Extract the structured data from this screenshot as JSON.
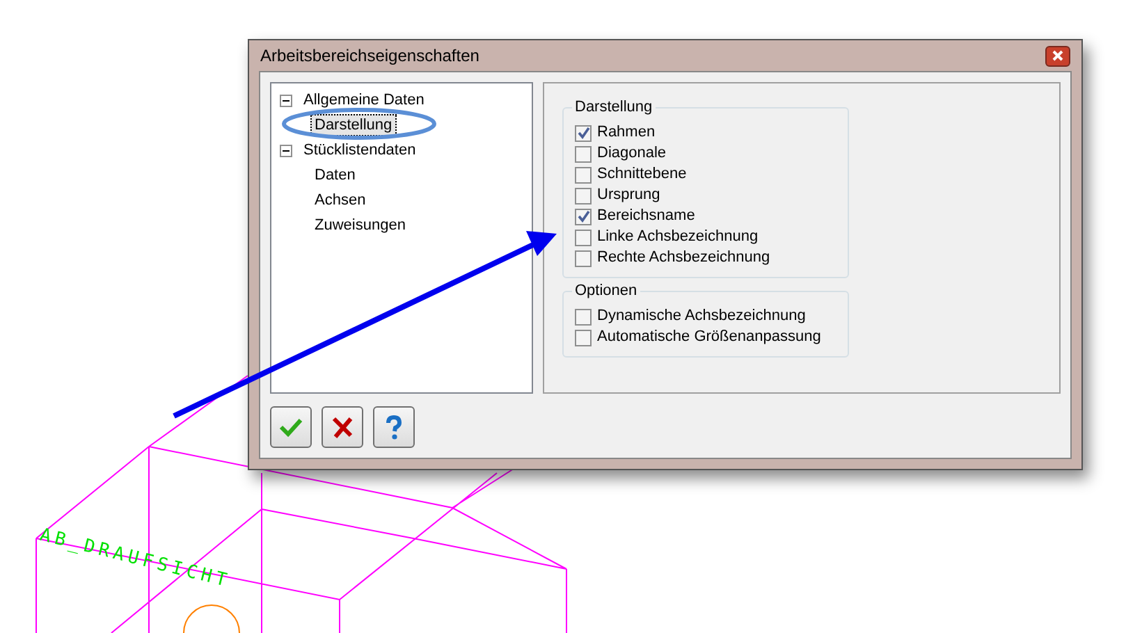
{
  "canvas": {
    "view_label": "AB_DRAUFSICHT"
  },
  "dialog": {
    "title": "Arbeitsbereichseigenschaften",
    "tree": [
      {
        "label": "Allgemeine Daten",
        "expanded": true,
        "selected": false,
        "children": [
          {
            "label": "Darstellung",
            "selected": true
          }
        ]
      },
      {
        "label": "Stücklistendaten",
        "expanded": true,
        "selected": false,
        "children": [
          {
            "label": "Daten",
            "selected": false
          },
          {
            "label": "Achsen",
            "selected": false
          },
          {
            "label": "Zuweisungen",
            "selected": false
          }
        ]
      }
    ],
    "groups": [
      {
        "title": "Darstellung",
        "options": [
          {
            "label": "Rahmen",
            "checked": true
          },
          {
            "label": "Diagonale",
            "checked": false
          },
          {
            "label": "Schnittebene",
            "checked": false
          },
          {
            "label": "Ursprung",
            "checked": false
          },
          {
            "label": "Bereichsname",
            "checked": true
          },
          {
            "label": "Linke Achsbezeichnung",
            "checked": false
          },
          {
            "label": "Rechte Achsbezeichnung",
            "checked": false
          }
        ]
      },
      {
        "title": "Optionen",
        "options": [
          {
            "label": "Dynamische Achsbezeichnung",
            "checked": false
          },
          {
            "label": "Automatische Größenanpassung",
            "checked": false
          }
        ]
      }
    ],
    "buttons": [
      {
        "kind": "ok"
      },
      {
        "kind": "cancel"
      },
      {
        "kind": "help"
      }
    ]
  }
}
